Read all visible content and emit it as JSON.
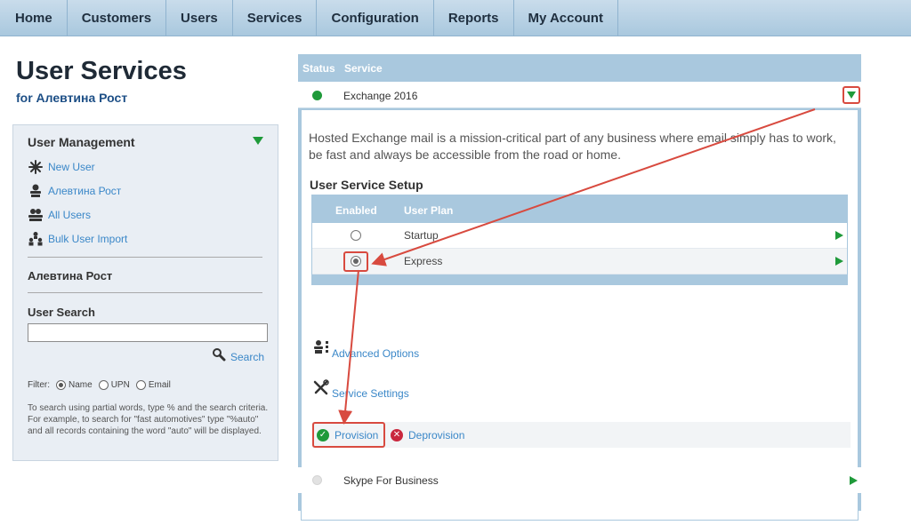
{
  "nav": {
    "items": [
      "Home",
      "Customers",
      "Users",
      "Services",
      "Configuration",
      "Reports",
      "My Account"
    ]
  },
  "page": {
    "title": "User Services",
    "subtitle": "for Алевтина Рост"
  },
  "left_panel": {
    "user_management": {
      "heading": "User Management",
      "links": [
        {
          "label": "New User",
          "icon": "new-user-icon"
        },
        {
          "label": "Алевтина Рост",
          "icon": "user-icon"
        },
        {
          "label": "All Users",
          "icon": "users-icon"
        },
        {
          "label": "Bulk User Import",
          "icon": "org-chart-icon"
        }
      ]
    },
    "current_user": "Алевтина Рост",
    "user_search": {
      "heading": "User Search",
      "input_value": "",
      "search_label": "Search",
      "filter_label": "Filter:",
      "filters": [
        {
          "label": "Name",
          "selected": true
        },
        {
          "label": "UPN",
          "selected": false
        },
        {
          "label": "Email",
          "selected": false
        }
      ],
      "help": "To search using partial words, type % and the search criteria. For example, to search for \"fast automotives\" type \"%auto\" and all records containing the word \"auto\" will be displayed."
    }
  },
  "services": {
    "header": {
      "status": "Status",
      "service": "Service"
    },
    "exchange": {
      "name": "Exchange 2016",
      "status_color": "#1f9a3a",
      "description": "Hosted Exchange mail is a mission-critical part of any business where email simply has to work, be fast and always be accessible from the road or home.",
      "setup_title": "User Service Setup",
      "plan_header": {
        "enabled": "Enabled",
        "plan": "User Plan"
      },
      "plans": [
        {
          "name": "Startup",
          "selected": false
        },
        {
          "name": "Express",
          "selected": true
        }
      ],
      "advanced_options": "Advanced Options",
      "service_settings": "Service Settings",
      "provision": "Provision",
      "deprovision": "Deprovision"
    },
    "skype": {
      "name": "Skype For Business",
      "status_color": "#dddddd"
    }
  },
  "colors": {
    "nav_bg": "#b6d1e5",
    "panel_blue": "#a9c8de",
    "link": "#3a87c8",
    "accent_green": "#1f9a3a",
    "annotation_red": "#d84a3f"
  }
}
